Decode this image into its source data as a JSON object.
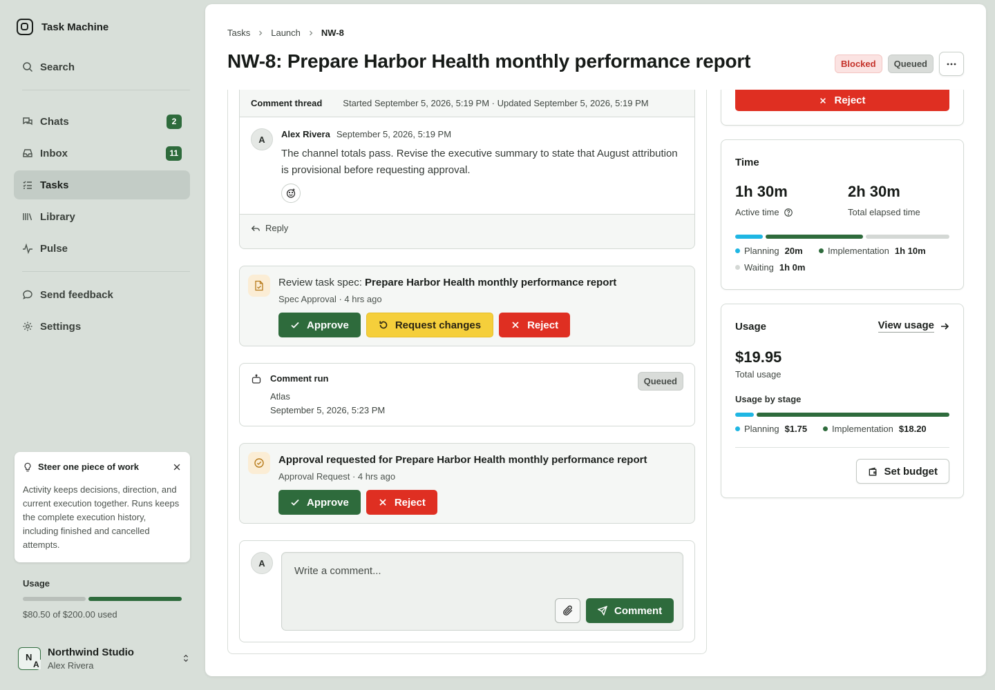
{
  "app": {
    "name": "Task Machine"
  },
  "sidebar": {
    "search_label": "Search",
    "nav": [
      {
        "label": "Chats",
        "badge": "2",
        "icon": "chats-icon"
      },
      {
        "label": "Inbox",
        "badge": "11",
        "icon": "inbox-icon"
      },
      {
        "label": "Tasks",
        "badge": "",
        "icon": "tasks-icon",
        "active": true
      },
      {
        "label": "Library",
        "badge": "",
        "icon": "library-icon"
      },
      {
        "label": "Pulse",
        "badge": "",
        "icon": "pulse-icon"
      }
    ],
    "feedback_label": "Send feedback",
    "settings_label": "Settings",
    "tip": {
      "title": "Steer one piece of work",
      "body": "Activity keeps decisions, direction, and current execution together. Runs keeps the complete execution history, including finished and cancelled attempts."
    },
    "usage": {
      "title": "Usage",
      "text": "$80.50 of $200.00 used",
      "used_fraction": 0.4025
    },
    "workspace": {
      "name": "Northwind Studio",
      "user": "Alex Rivera",
      "avatar_n": "N",
      "avatar_a": "A"
    }
  },
  "breadcrumb": {
    "root": "Tasks",
    "parent": "Launch",
    "current": "NW-8"
  },
  "task": {
    "title": "NW-8: Prepare Harbor Health monthly performance report",
    "badges": {
      "blocked": "Blocked",
      "queued": "Queued"
    },
    "more_label": "···"
  },
  "thread": {
    "title": "Comment thread",
    "meta": "Started September 5, 2026, 5:19 PM · Updated September 5, 2026, 5:19 PM",
    "comment": {
      "avatar": "A",
      "author": "Alex Rivera",
      "time": "September 5, 2026, 5:19 PM",
      "text": "The channel totals pass. Revise the executive summary to state that August attribution is provisional before requesting approval."
    },
    "reply_label": "Reply"
  },
  "spec_review": {
    "prefix": "Review task spec: ",
    "name": "Prepare Harbor Health monthly performance report",
    "sub": "Spec Approval · 4 hrs ago",
    "approve_label": "Approve",
    "changes_label": "Request changes",
    "reject_label": "Reject"
  },
  "comment_run": {
    "title": "Comment run",
    "agent": "Atlas",
    "time": "September 5, 2026, 5:23 PM",
    "status": "Queued"
  },
  "approval_request": {
    "title": "Approval requested for Prepare Harbor Health monthly performance report",
    "sub": "Approval Request · 4 hrs ago",
    "approve_label": "Approve",
    "reject_label": "Reject"
  },
  "composer": {
    "avatar": "A",
    "placeholder": "Write a comment...",
    "submit_label": "Comment"
  },
  "right": {
    "reject_label": "Reject",
    "time": {
      "title": "Time",
      "active_value": "1h 30m",
      "active_label": "Active time",
      "elapsed_value": "2h 30m",
      "elapsed_label": "Total elapsed time",
      "breakdown": [
        {
          "label": "Planning",
          "value": "20m",
          "minutes": 20,
          "color": "#1fb6e3"
        },
        {
          "label": "Implementation",
          "value": "1h 10m",
          "minutes": 70,
          "color": "#2e6b3c"
        },
        {
          "label": "Waiting",
          "value": "1h 0m",
          "minutes": 60,
          "color": "#d4d8d5"
        }
      ]
    },
    "usage": {
      "title": "Usage",
      "view_label": "View usage",
      "total_value": "$19.95",
      "total_label": "Total usage",
      "by_stage_label": "Usage by stage",
      "stages": [
        {
          "label": "Planning",
          "value": "$1.75",
          "amount": 1.75,
          "color": "#1fb6e3"
        },
        {
          "label": "Implementation",
          "value": "$18.20",
          "amount": 18.2,
          "color": "#2e6b3c"
        }
      ],
      "budget_label": "Set budget"
    }
  },
  "colors": {
    "accent_green": "#2e6b3c",
    "danger_red": "#df2f22",
    "warning_yellow": "#f5cf3b",
    "planning_blue": "#1fb6e3"
  }
}
